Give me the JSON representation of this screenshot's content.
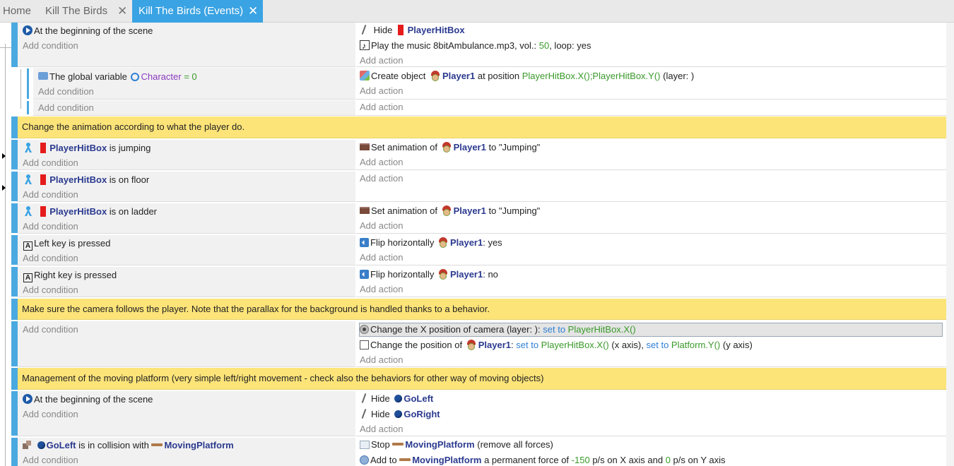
{
  "tabs": [
    {
      "label": "Home"
    },
    {
      "label": "Kill The Birds"
    },
    {
      "label": "Kill The Birds (Events)"
    }
  ],
  "common": {
    "add_condition": "Add condition",
    "add_action": "Add action"
  },
  "events": {
    "e1": {
      "cond": "At the beginning of the scene",
      "a1_pre": "Hide",
      "a1_obj": "PlayerHitBox",
      "a2_pre": "Play the music 8bitAmbulance.mp3, vol.:",
      "a2_vol": "50",
      "a2_post": ", loop: yes"
    },
    "e1s1": {
      "cond_pre": "The global variable",
      "cond_var": "Character",
      "cond_eq": "=",
      "cond_val": "0",
      "a_pre": "Create object",
      "a_obj": "Player1",
      "a_mid": "at position",
      "a_expr": "PlayerHitBox.X();PlayerHitBox.Y()",
      "a_post": "(layer: )"
    },
    "c1": "Change the animation according to what the player do.",
    "e2": {
      "cond_obj": "PlayerHitBox",
      "cond_post": "is jumping",
      "a_pre": "Set animation of",
      "a_obj": "Player1",
      "a_post": "to \"Jumping\""
    },
    "e3": {
      "cond_obj": "PlayerHitBox",
      "cond_post": "is on floor"
    },
    "e4": {
      "cond_obj": "PlayerHitBox",
      "cond_post": "is on ladder",
      "a_pre": "Set animation of",
      "a_obj": "Player1",
      "a_post": "to \"Jumping\""
    },
    "e5": {
      "key": "A",
      "cond": "Left key is pressed",
      "a_pre": "Flip horizontally",
      "a_obj": "Player1",
      "a_post": ": yes"
    },
    "e6": {
      "key": "A",
      "cond": "Right key is pressed",
      "a_pre": "Flip horizontally",
      "a_obj": "Player1",
      "a_post": ": no"
    },
    "c2": "Make sure the camera follows the player. Note that the parallax for the background is handled thanks to a behavior.",
    "e7": {
      "a1_pre": "Change the X position of camera  (layer: ):",
      "a1_set": "set to",
      "a1_expr": "PlayerHitBox.X()",
      "a2_pre": "Change the position of",
      "a2_obj": "Player1",
      "a2_colon": ":",
      "a2_set1": "set to",
      "a2_expr1": "PlayerHitBox.X()",
      "a2_mid": "(x axis),",
      "a2_set2": "set to",
      "a2_expr2": "Platform.Y()",
      "a2_post": "(y axis)"
    },
    "c3": "Management of the moving platform (very simple left/right movement - check also the behaviors for other way of moving objects)",
    "e8": {
      "cond": "At the beginning of the scene",
      "a1_pre": "Hide",
      "a1_obj": "GoLeft",
      "a2_pre": "Hide",
      "a2_obj": "GoRight"
    },
    "e9": {
      "cond_obj": "GoLeft",
      "cond_mid": "is in collision with",
      "cond_obj2": "MovingPlatform",
      "a1_pre": "Stop",
      "a1_obj": "MovingPlatform",
      "a1_post": "(remove all forces)",
      "a2_pre": "Add to",
      "a2_obj": "MovingPlatform",
      "a2_mid": "a permanent force of",
      "a2_x": "-150",
      "a2_mid2": "p/s on X axis and",
      "a2_y": "0",
      "a2_post": "p/s on Y axis"
    }
  },
  "colors": {
    "accent": "#3aa3e3",
    "event_bar": "#4aa9e0",
    "comment_bg": "#fce479",
    "object_text": "#2b3a8f",
    "value_green": "#3a9a2a",
    "keyword_blue": "#2f7fd6"
  },
  "icons": [
    "play-icon",
    "hide-icon",
    "music-icon",
    "variable-icon",
    "create-object-icon",
    "player-sprite-icon",
    "platformer-icon",
    "animation-icon",
    "keyboard-icon",
    "flip-icon",
    "camera-icon",
    "position-icon",
    "collision-icon",
    "force-icon",
    "stop-icon"
  ]
}
